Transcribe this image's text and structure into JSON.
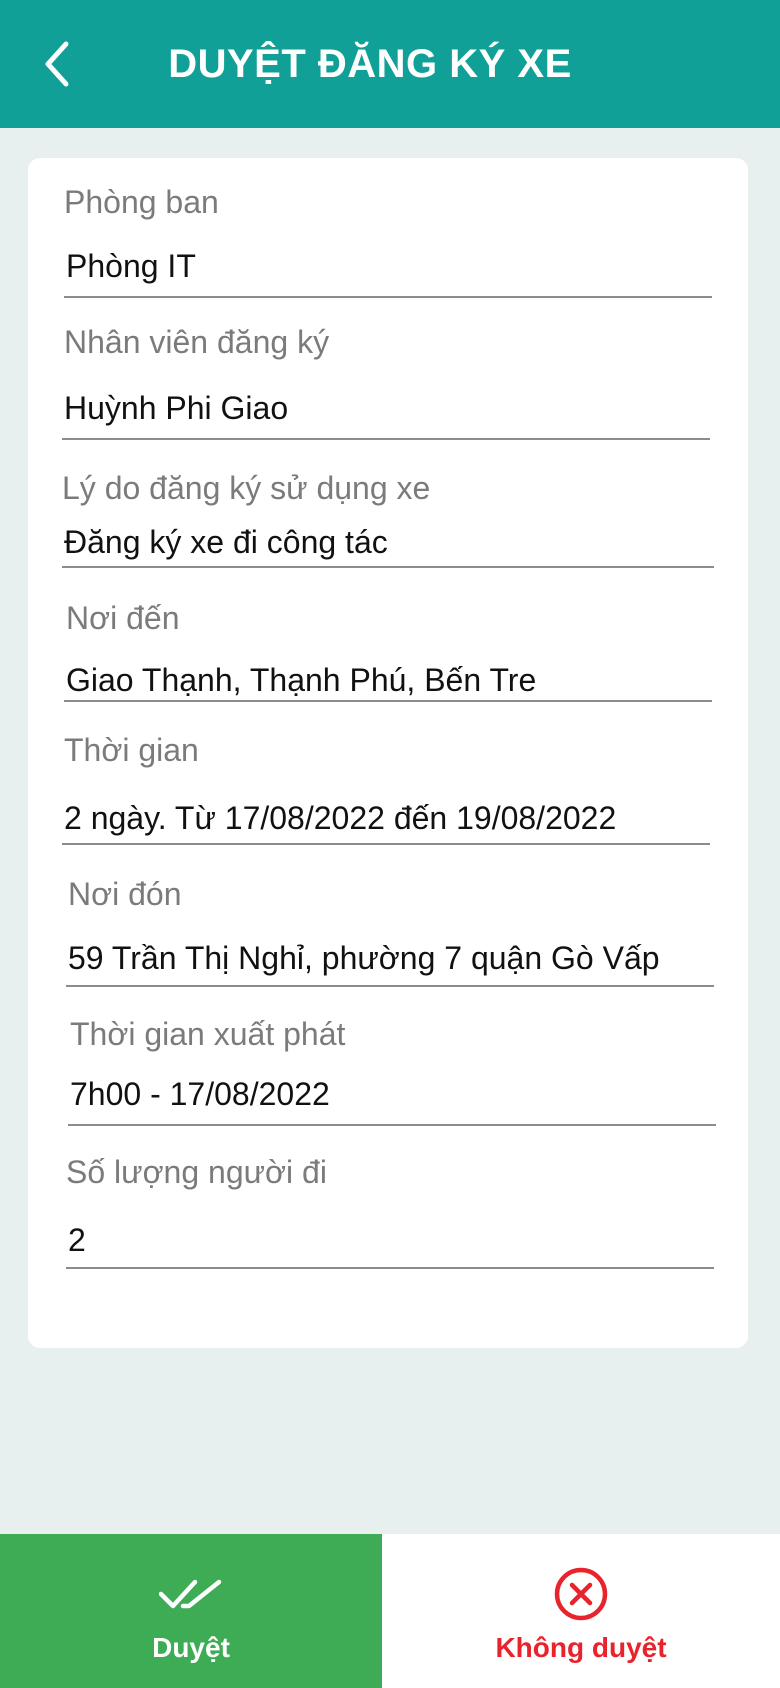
{
  "header": {
    "title": "DUYỆT ĐĂNG KÝ XE",
    "back_icon": "chevron-left-icon",
    "background": "#11a097"
  },
  "form": {
    "fields": [
      {
        "label": "Phòng ban",
        "value": "Phòng  IT"
      },
      {
        "label": "Nhân viên đăng ký",
        "value": "Huỳnh Phi Giao"
      },
      {
        "label": "Lý do đăng ký sử dụng xe",
        "value": "Đăng ký xe đi công tác"
      },
      {
        "label": "Nơi đến",
        "value": "Giao Thạnh, Thạnh Phú, Bến Tre"
      },
      {
        "label": "Thời gian",
        "value": "2 ngày. Từ 17/08/2022 đến 19/08/2022"
      },
      {
        "label": "Nơi đón",
        "value": "59 Trần Thị Nghỉ, phường 7 quận Gò Vấp"
      },
      {
        "label": "Thời gian xuất phát",
        "value": "7h00 - 17/08/2022"
      },
      {
        "label": "Số lượng người đi",
        "value": "2"
      }
    ]
  },
  "actions": {
    "approve": {
      "label": "Duyệt",
      "icon": "double-check-icon",
      "color": "#3dac55"
    },
    "reject": {
      "label": "Không duyệt",
      "icon": "close-circle-icon",
      "color": "#e8232b"
    }
  }
}
